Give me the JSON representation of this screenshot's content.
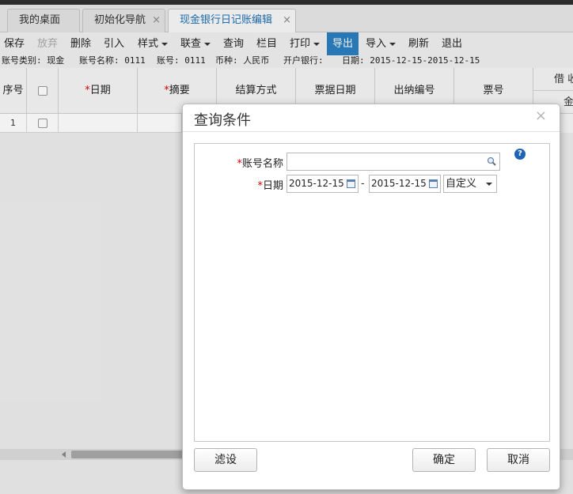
{
  "tabs": [
    {
      "label": "我的桌面"
    },
    {
      "label": "初始化导航",
      "close": "×"
    },
    {
      "label": "现金银行日记账编辑",
      "close": "×"
    }
  ],
  "toolbar": {
    "save": "保存",
    "discard": "放弃",
    "delete": "删除",
    "import_in": "引入",
    "style": "样式",
    "query_link": "联查",
    "query": "查询",
    "columns": "栏目",
    "print": "打印",
    "export": "导出",
    "import": "导入",
    "refresh": "刷新",
    "exit": "退出"
  },
  "info": {
    "account_type": "账号类别: 现金",
    "account_name": "账号名称: 0111",
    "account_no": "账号: 0111",
    "currency": "币种: 人民币",
    "bank": "开户银行:",
    "date_range": "日期: 2015-12-15-2015-12-15"
  },
  "grid": {
    "col_seq": "序号",
    "col_date": "日期",
    "col_summary": "摘要",
    "col_settle": "结算方式",
    "col_bill_date": "票据日期",
    "col_cashier_no": "出纳编号",
    "col_bill_no": "票号",
    "col_debit": "借 收",
    "col_amount": "金",
    "required_mark": "*",
    "rows": [
      {
        "seq": "1"
      }
    ]
  },
  "dialog": {
    "title": "查询条件",
    "close": "×",
    "help": "?",
    "required_mark": "*",
    "account_label": "账号名称",
    "account_value": "",
    "date_label": "日期",
    "date_from": "2015-12-15",
    "date_sep": "-",
    "date_to": "2015-12-15",
    "period_option": "自定义",
    "filter_button": "滤设",
    "ok_button": "确定",
    "cancel_button": "取消"
  }
}
